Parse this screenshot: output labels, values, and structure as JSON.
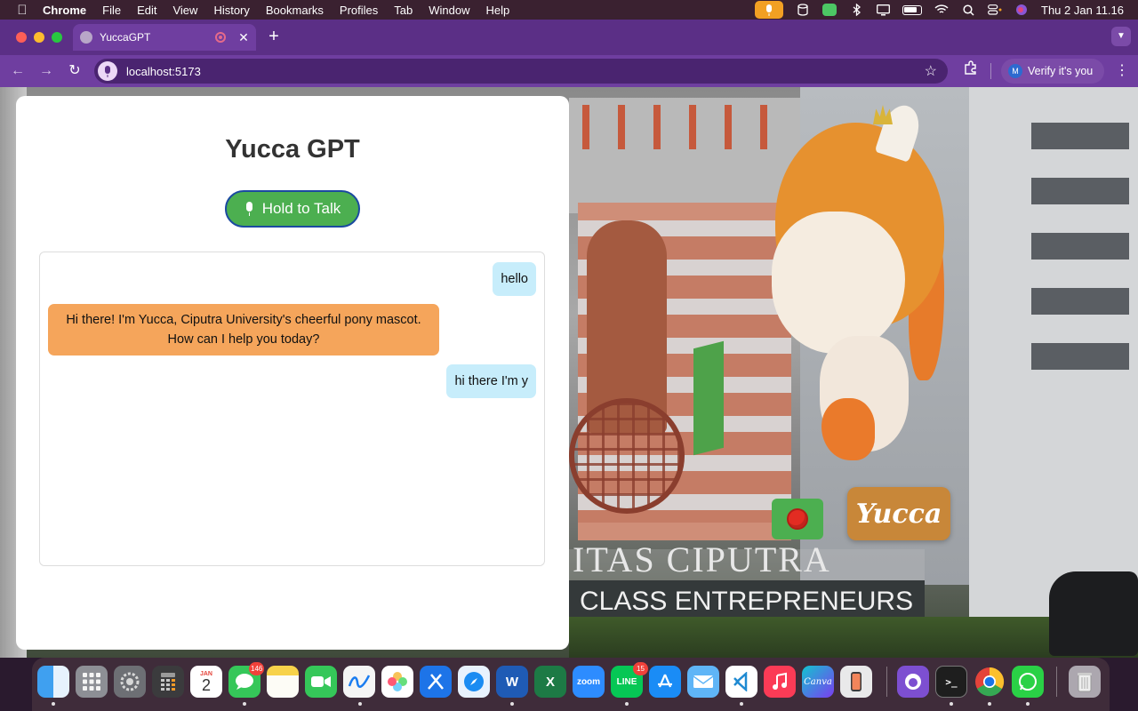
{
  "menubar": {
    "app_name": "Chrome",
    "menus": [
      "File",
      "Edit",
      "View",
      "History",
      "Bookmarks",
      "Profiles",
      "Tab",
      "Window",
      "Help"
    ],
    "clock": "Thu 2 Jan  11.16"
  },
  "browser": {
    "tab_title": "YuccaGPT",
    "tab_close": "✕",
    "new_tab": "+",
    "url": "localhost:5173",
    "profile_initial": "M",
    "profile_label": "Verify it's you"
  },
  "app": {
    "title": "Yucca GPT",
    "talk_button": "Hold to Talk",
    "messages": [
      {
        "role": "user",
        "text": "hello"
      },
      {
        "role": "bot",
        "text": "Hi there! I'm Yucca, Ciputra University's cheerful pony mascot. How can I help you today?"
      },
      {
        "role": "user",
        "text": "hi there I'm y"
      }
    ],
    "mascot_name": "Yucca"
  },
  "background": {
    "sign_line_1": "ITAS CIPUTRA",
    "sign_line_2": "CLASS ENTREPRENEURS"
  },
  "dock": {
    "messages_badge": "146",
    "line_badge": "15",
    "calendar_month": "JAN",
    "calendar_day": "2",
    "zoom_label": "zoom",
    "line_label": "LINE",
    "canva_label": "Canva"
  },
  "colors": {
    "tab_bar": "#5b2f86",
    "toolbar": "#6f3ea0",
    "talk_button": "#4caf50",
    "user_bubble": "#c7edfb",
    "bot_bubble": "#f5a55b",
    "mascot_badge": "#c88739"
  }
}
